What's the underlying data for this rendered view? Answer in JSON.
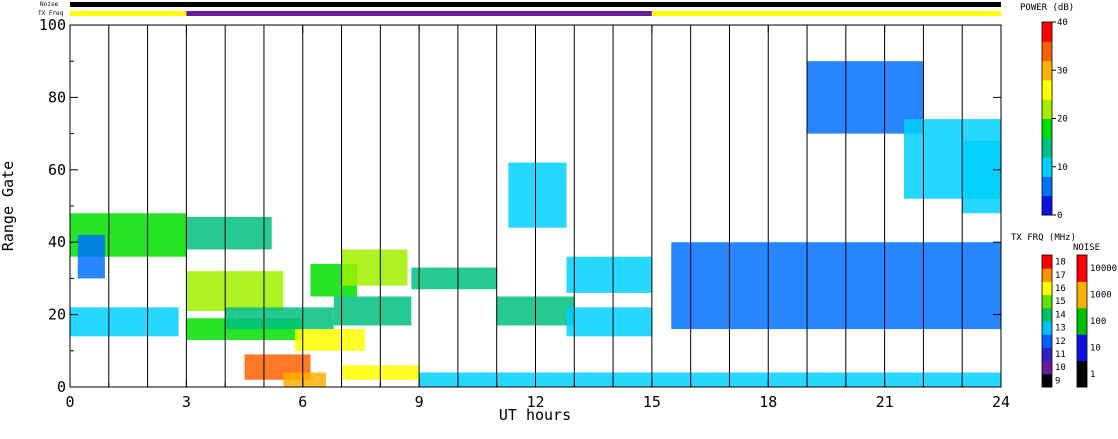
{
  "chart_data": {
    "type": "heatmap",
    "title": "",
    "xlabel": "UT hours",
    "ylabel": "Range Gate",
    "xlim": [
      0,
      24
    ],
    "ylim": [
      0,
      100
    ],
    "x_ticks": [
      "0",
      "3",
      "6",
      "9",
      "12",
      "15",
      "18",
      "21",
      "24"
    ],
    "y_ticks": [
      "0",
      "20",
      "40",
      "60",
      "80",
      "100"
    ],
    "scan_boundaries_hours": [
      1,
      2,
      3,
      4,
      5,
      6,
      7,
      8,
      9,
      10,
      11,
      12,
      13,
      14,
      15,
      16,
      17,
      18,
      19,
      20,
      21,
      22,
      23,
      24
    ],
    "noise_bar": {
      "label": "Noise",
      "color": "#000000"
    },
    "tx_freq_bar": {
      "label": "TX Freq",
      "segments": [
        {
          "start": 0,
          "end": 3,
          "color": "#ffff00"
        },
        {
          "start": 3,
          "end": 15,
          "color": "#6a1b9a"
        },
        {
          "start": 15,
          "end": 24,
          "color": "#ffff00"
        }
      ]
    },
    "power_scale": {
      "label": "POWER (dB)",
      "range": [
        0,
        40
      ],
      "ticks": [
        "0",
        "10",
        "20",
        "30",
        "40"
      ],
      "colors": [
        "#1010e0",
        "#0070ff",
        "#00d0ff",
        "#00c080",
        "#00e000",
        "#a0f000",
        "#ffff00",
        "#ffb000",
        "#ff6000",
        "#ff0000"
      ]
    },
    "tx_freq_scale": {
      "label": "TX FRQ (MHz)",
      "ticks": [
        "9",
        "10",
        "11",
        "12",
        "13",
        "14",
        "15",
        "16",
        "17",
        "18"
      ],
      "colors": [
        "#000000",
        "#6a1b9a",
        "#3020c0",
        "#0060ff",
        "#00c0ff",
        "#00c060",
        "#60e000",
        "#ffff00",
        "#ff9000",
        "#ff0000"
      ]
    },
    "noise_scale": {
      "label": "NOISE",
      "ticks": [
        "1",
        "10",
        "100",
        "1000",
        "10000"
      ],
      "colors": [
        "#000000",
        "#1010e0",
        "#00c000",
        "#ffb000",
        "#ff0000"
      ]
    },
    "echo_regions": [
      {
        "x": [
          0.0,
          3.0
        ],
        "y": [
          36,
          48
        ],
        "power": 16
      },
      {
        "x": [
          0.0,
          2.8
        ],
        "y": [
          14,
          22
        ],
        "power": 8
      },
      {
        "x": [
          0.2,
          0.9
        ],
        "y": [
          30,
          42
        ],
        "power": 6
      },
      {
        "x": [
          3.0,
          5.2
        ],
        "y": [
          38,
          47
        ],
        "power": 15
      },
      {
        "x": [
          3.0,
          5.5
        ],
        "y": [
          21,
          32
        ],
        "power": 20
      },
      {
        "x": [
          3.0,
          6.0
        ],
        "y": [
          13,
          19
        ],
        "power": 17
      },
      {
        "x": [
          4.0,
          6.8
        ],
        "y": [
          16,
          22
        ],
        "power": 14
      },
      {
        "x": [
          4.5,
          6.2
        ],
        "y": [
          2,
          9
        ],
        "power": 33
      },
      {
        "x": [
          5.5,
          6.6
        ],
        "y": [
          0,
          4
        ],
        "power": 30
      },
      {
        "x": [
          5.8,
          7.6
        ],
        "y": [
          10,
          16
        ],
        "power": 24
      },
      {
        "x": [
          6.2,
          7.4
        ],
        "y": [
          25,
          34
        ],
        "power": 16
      },
      {
        "x": [
          7.0,
          8.7
        ],
        "y": [
          28,
          38
        ],
        "power": 21
      },
      {
        "x": [
          6.8,
          8.8
        ],
        "y": [
          17,
          25
        ],
        "power": 12
      },
      {
        "x": [
          7.0,
          9.0
        ],
        "y": [
          2,
          6
        ],
        "power": 26
      },
      {
        "x": [
          8.8,
          11.0
        ],
        "y": [
          27,
          33
        ],
        "power": 12
      },
      {
        "x": [
          11.0,
          13.0
        ],
        "y": [
          17,
          25
        ],
        "power": 14
      },
      {
        "x": [
          11.3,
          12.8
        ],
        "y": [
          44,
          62
        ],
        "power": 10
      },
      {
        "x": [
          12.8,
          15.0
        ],
        "y": [
          26,
          36
        ],
        "power": 10
      },
      {
        "x": [
          12.8,
          15.0
        ],
        "y": [
          14,
          22
        ],
        "power": 9
      },
      {
        "x": [
          9.0,
          24.0
        ],
        "y": [
          0,
          4
        ],
        "power": 9
      },
      {
        "x": [
          15.5,
          24.0
        ],
        "y": [
          16,
          40
        ],
        "power": 4
      },
      {
        "x": [
          19.0,
          22.0
        ],
        "y": [
          70,
          90
        ],
        "power": 5
      },
      {
        "x": [
          21.5,
          24.0
        ],
        "y": [
          52,
          74
        ],
        "power": 8
      },
      {
        "x": [
          23.0,
          24.0
        ],
        "y": [
          48,
          68
        ],
        "power": 11
      }
    ]
  }
}
